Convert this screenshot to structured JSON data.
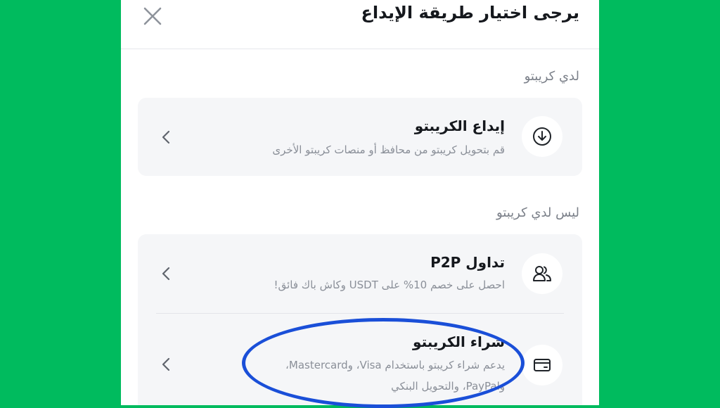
{
  "header": {
    "title": "يرجى اختيار طريقة الإيداع",
    "close_icon": "close-icon"
  },
  "sections": [
    {
      "label": "لدي كريبتو",
      "items": [
        {
          "title": "إيداع الكريبتو",
          "subtitle": "قم بتحويل كريبتو من محافظ أو منصات كريبتو الأخرى",
          "icon": "download-icon"
        }
      ]
    },
    {
      "label": "ليس لدي كريبتو",
      "items": [
        {
          "title": "تداول P2P",
          "subtitle": "احصل على خصم 10% على USDT وكاش باك فائق!",
          "icon": "users-icon"
        },
        {
          "title": "شراء الكريبتو",
          "subtitle_lines": [
            "يدعم شراء كريبتو باستخدام Visa، وMastercard،",
            "وPayPal، والتحويل البنكي"
          ],
          "icon": "card-icon"
        }
      ]
    }
  ],
  "colors": {
    "background": "#00bb5e",
    "sheet": "#ffffff",
    "card": "#f5f6f8",
    "highlight": "#1a4fd8"
  }
}
